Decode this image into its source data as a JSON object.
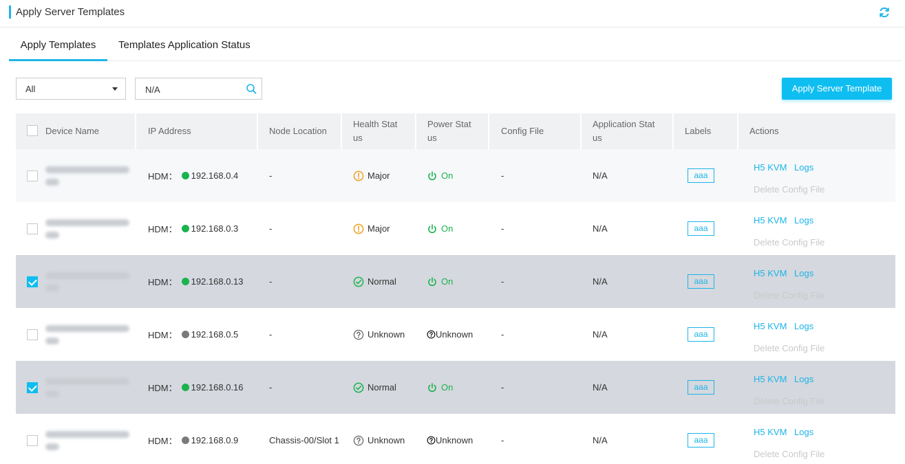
{
  "header": {
    "title": "Apply Server Templates",
    "refresh_icon": "refresh-icon",
    "accent": "#1cb4e8"
  },
  "tabs": [
    {
      "label": "Apply Templates",
      "active": true
    },
    {
      "label": "Templates Application Status",
      "active": false
    }
  ],
  "filter": {
    "selected": "All"
  },
  "search": {
    "value": "N/A",
    "icon": "search-icon"
  },
  "apply_button": {
    "label": "Apply Server Template",
    "color": "#0fbef1"
  },
  "table": {
    "columns": [
      "Device Name",
      "IP Address",
      "Node Location",
      "Health Status",
      "Power Status",
      "Config File",
      "Application Status",
      "Labels",
      "Actions"
    ],
    "column_display": {
      "health": [
        "Health Stat",
        "us"
      ],
      "power": [
        "Power Stat",
        "us"
      ],
      "app": [
        "Application Stat",
        "us"
      ]
    },
    "rows": [
      {
        "checked": false,
        "ip_prefix": "HDM：",
        "ip": "192.168.0.4",
        "ip_online": true,
        "node": "-",
        "health": "Major",
        "power": "On",
        "config": "-",
        "app_status": "N/A",
        "label": "aaa",
        "actions": [
          "H5 KVM",
          "Logs",
          "Delete Config File"
        ]
      },
      {
        "checked": false,
        "ip_prefix": "HDM：",
        "ip": "192.168.0.3",
        "ip_online": true,
        "node": "-",
        "health": "Major",
        "power": "On",
        "config": "-",
        "app_status": "N/A",
        "label": "aaa",
        "actions": [
          "H5 KVM",
          "Logs",
          "Delete Config File"
        ]
      },
      {
        "checked": true,
        "ip_prefix": "HDM：",
        "ip": "192.168.0.13",
        "ip_online": true,
        "node": "-",
        "health": "Normal",
        "power": "On",
        "config": "-",
        "app_status": "N/A",
        "label": "aaa",
        "actions": [
          "H5 KVM",
          "Logs",
          "Delete Config File"
        ]
      },
      {
        "checked": false,
        "ip_prefix": "HDM：",
        "ip": "192.168.0.5",
        "ip_online": false,
        "node": "-",
        "health": "Unknown",
        "power": "Unknown",
        "config": "-",
        "app_status": "N/A",
        "label": "aaa",
        "actions": [
          "H5 KVM",
          "Logs",
          "Delete Config File"
        ]
      },
      {
        "checked": true,
        "ip_prefix": "HDM：",
        "ip": "192.168.0.16",
        "ip_online": true,
        "node": "-",
        "health": "Normal",
        "power": "On",
        "config": "-",
        "app_status": "N/A",
        "label": "aaa",
        "actions": [
          "H5 KVM",
          "Logs",
          "Delete Config File"
        ]
      },
      {
        "checked": false,
        "ip_prefix": "HDM：",
        "ip": "192.168.0.9",
        "ip_online": false,
        "node": "Chassis-00/Slot 1",
        "health": "Unknown",
        "power": "Unknown",
        "config": "-",
        "app_status": "N/A",
        "label": "aaa",
        "actions": [
          "H5 KVM",
          "Logs",
          "Delete Config File"
        ]
      }
    ]
  },
  "colors": {
    "major": "#f0a020",
    "normal": "#1ab34e",
    "unknown": "#666666",
    "online": "#1ab34e",
    "offline": "#7a7a7a",
    "selected_row": "#d5d8de"
  }
}
